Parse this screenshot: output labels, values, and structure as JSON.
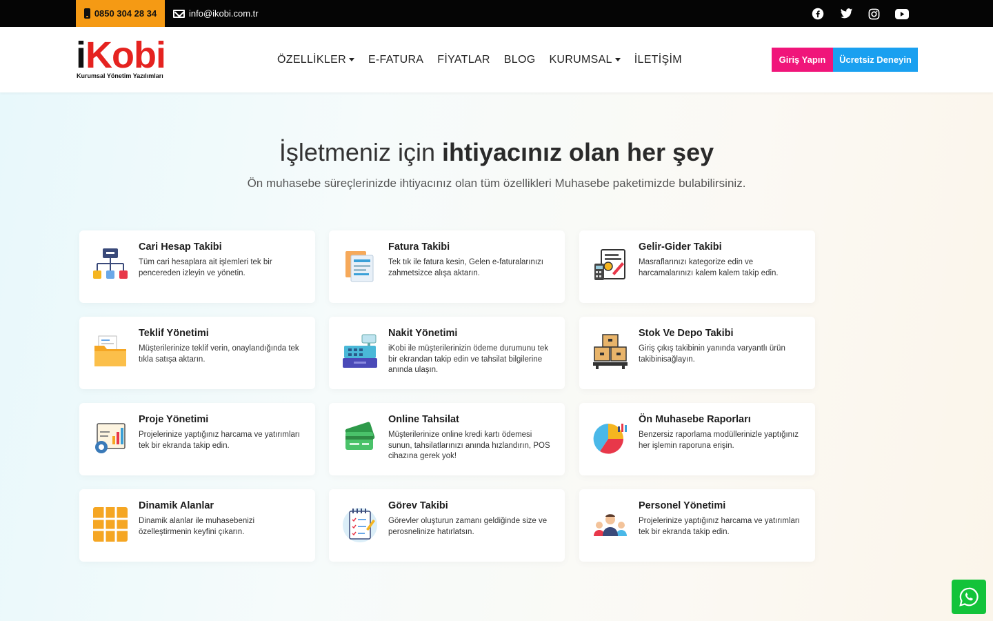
{
  "topbar": {
    "phone": "0850 304 28 34",
    "email": "info@ikobi.com.tr"
  },
  "logo": {
    "letter_i": "i",
    "word": "Kobi",
    "tagline": "Kurumsal Yönetim Yazılımları"
  },
  "nav": {
    "items": [
      {
        "label": "ÖZELLİKLER"
      },
      {
        "label": "E-FATURA"
      },
      {
        "label": "FİYATLAR"
      },
      {
        "label": "BLOG"
      },
      {
        "label": "KURUMSAL"
      },
      {
        "label": "İLETİŞİM"
      }
    ]
  },
  "header": {
    "login_label": "Giriş Yapın",
    "trial_label": "Ücretsiz Deneyin"
  },
  "hero": {
    "title_light": "İşletmeniz için ",
    "title_bold": "ihtiyacınız olan her şey",
    "subtitle": "Ön muhasebe süreçlerinizde ihtiyacınız olan tüm özellikleri Muhasebe paketimizde bulabilirsiniz."
  },
  "features": [
    {
      "title": "Cari Hesap Takibi",
      "desc": "Tüm cari hesaplara ait işlemleri tek bir pencereden izleyin ve yönetin."
    },
    {
      "title": "Fatura Takibi",
      "desc": "Tek tık ile fatura kesin, Gelen e-faturalarınızı zahmetsizce alışa aktarın."
    },
    {
      "title": "Gelir-Gider Takibi",
      "desc": "Masraflarınızı kategorize edin ve harcamalarınızı kalem kalem takip edin."
    },
    {
      "title": "Teklif Yönetimi",
      "desc": "Müşterilerinize teklif verin, onaylandığında tek tıkla satışa aktarın."
    },
    {
      "title": "Nakit Yönetimi",
      "desc": "iKobi ile müşterilerinizin ödeme durumunu tek bir ekrandan takip edin ve tahsilat bilgilerine anında ulaşın."
    },
    {
      "title": "Stok Ve Depo Takibi",
      "desc": "Giriş çıkış takibinin yanında varyantlı ürün takibinisağlayın."
    },
    {
      "title": "Proje Yönetimi",
      "desc": "Projelerinize yaptığınız harcama ve yatırımları tek bir ekranda takip edin."
    },
    {
      "title": "Online Tahsilat",
      "desc": "Müşterilerinize online kredi kartı ödemesi sunun, tahsilatlarınızı anında hızlandırın, POS cihazına gerek yok!"
    },
    {
      "title": "Ön Muhasebe Raporları",
      "desc": "Benzersiz raporlama modüllerinizle yaptığınız her işlemin raporuna erişin."
    },
    {
      "title": "Dinamik Alanlar",
      "desc": "Dinamik alanlar ile muhasebenizi özelleştirmenin keyfini çıkarın."
    },
    {
      "title": "Görev Takibi",
      "desc": "Görevler oluşturun zamanı geldiğinde size ve perosnelinize hatırlatsın."
    },
    {
      "title": "Personel Yönetimi",
      "desc": "Projelerinize yaptığınız harcama ve yatırımları tek bir ekranda takip edin."
    }
  ],
  "colors": {
    "topbar_bg": "#050505",
    "phone_pill": "#f59a14",
    "login_button": "#f0157a",
    "trial_button": "#1aa0f0",
    "logo_red": "#e52320",
    "whatsapp": "#13c33a"
  },
  "icons": {
    "social": [
      "facebook-icon",
      "twitter-icon",
      "instagram-icon",
      "youtube-icon"
    ],
    "whatsapp": "whatsapp-icon"
  }
}
